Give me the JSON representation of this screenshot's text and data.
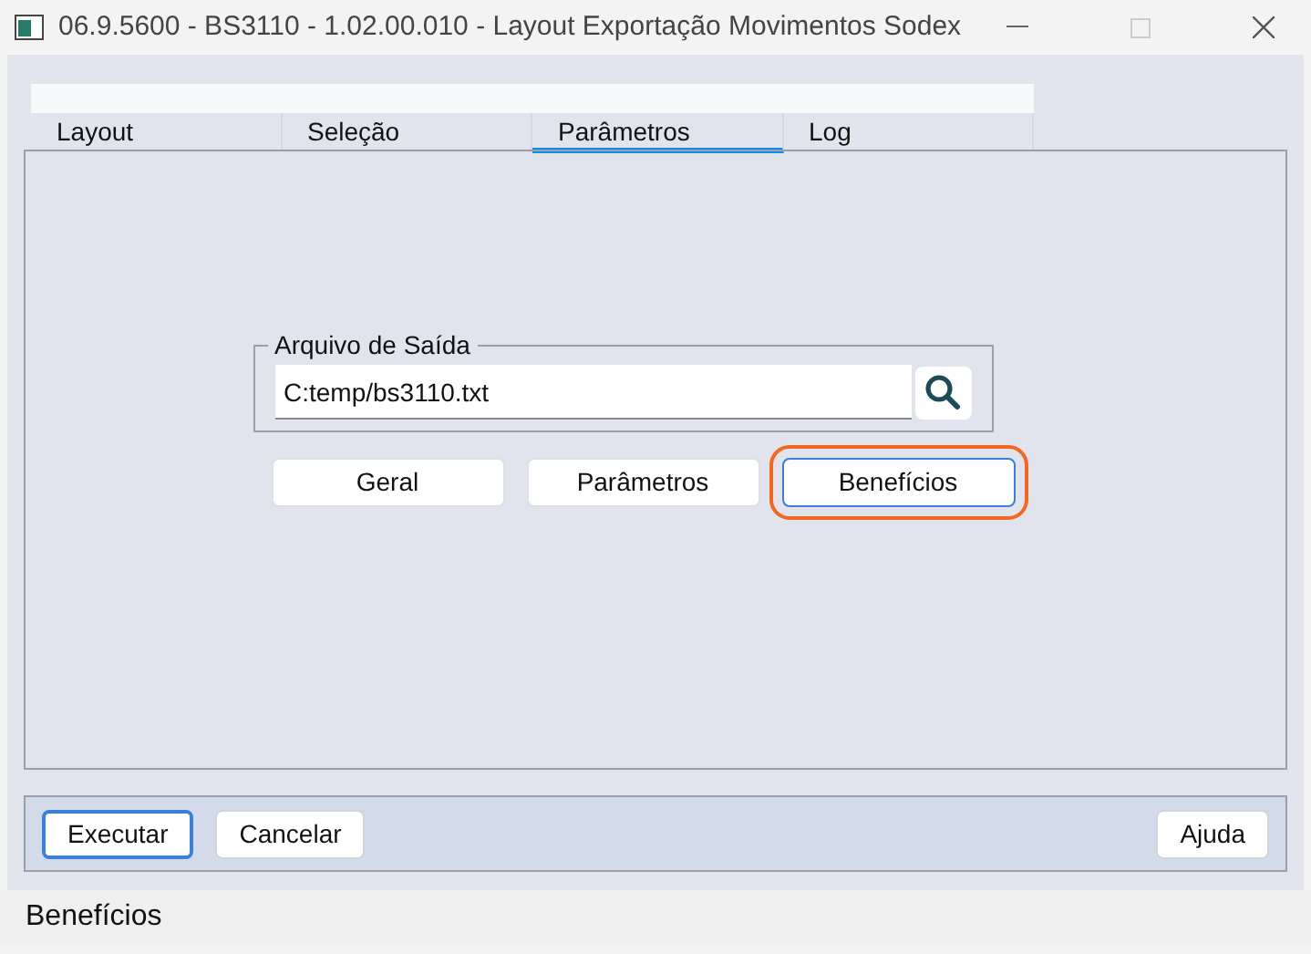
{
  "window": {
    "title": "06.9.5600 - BS3110 - 1.02.00.010 - Layout Exportação Movimentos Sodex"
  },
  "tabs": [
    {
      "label": "Layout",
      "selected": false
    },
    {
      "label": "Seleção",
      "selected": false
    },
    {
      "label": "Parâmetros",
      "selected": true
    },
    {
      "label": "Log",
      "selected": false
    }
  ],
  "output_file": {
    "legend": "Arquivo de Saída",
    "value": "C:temp/bs3110.txt"
  },
  "section_buttons": [
    {
      "label": "Geral",
      "highlighted": false
    },
    {
      "label": "Parâmetros",
      "highlighted": false
    },
    {
      "label": "Benefícios",
      "highlighted": true
    }
  ],
  "footer_buttons": [
    {
      "label": "Executar",
      "focused": true
    },
    {
      "label": "Cancelar",
      "focused": false
    },
    {
      "label": "Ajuda",
      "focused": false
    }
  ],
  "status_bar": "Benefícios"
}
